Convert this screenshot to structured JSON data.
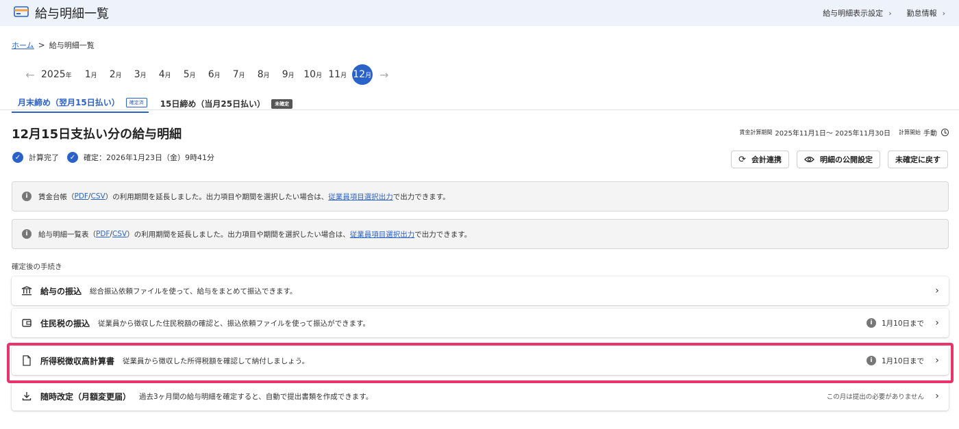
{
  "header": {
    "title": "給与明細一覧",
    "links": [
      {
        "label": "給与明細表示設定"
      },
      {
        "label": "勤怠情報"
      }
    ],
    "chevron": "›"
  },
  "breadcrumb": {
    "home": "ホーム",
    "separator": ">",
    "current": "給与明細一覧"
  },
  "months": {
    "prev_arrow": "←",
    "next_arrow": "→",
    "year": "2025",
    "year_suffix": "年",
    "month_suffix": "月",
    "items": [
      "1",
      "2",
      "3",
      "4",
      "5",
      "6",
      "7",
      "8",
      "9",
      "10",
      "11",
      "12"
    ],
    "selected": "12"
  },
  "tabs": [
    {
      "label": "月末締め（翌月15日払い）",
      "badge": "確定済",
      "active": true
    },
    {
      "label": "15日締め（当月25日払い）",
      "badge": "未確定",
      "active": false
    }
  ],
  "page": {
    "title": "12月15日支払い分の給与明細",
    "calc_period_label": "賃金計算期間",
    "calc_period_value": "2025年11月1日〜 2025年11月30日",
    "calc_start_label": "計算開始",
    "calc_start_value": "手動"
  },
  "status": {
    "calc_done": "計算完了",
    "confirmed": "確定：2026年1月23日（金）9時41分"
  },
  "buttons": {
    "accounting": "会計連携",
    "publish_settings": "明細の公開設定",
    "revert": "未確定に戻す"
  },
  "notices": [
    {
      "prefix": "賃金台帳（",
      "pdf": "PDF",
      "slash": "/",
      "csv": "CSV",
      "middle": "）の利用期間を延長しました。出力項目や期間を選択したい場合は、",
      "link": "従業員項目選択出力",
      "suffix": "で出力できます。"
    },
    {
      "prefix": "給与明細一覧表（",
      "pdf": "PDF",
      "slash": "/",
      "csv": "CSV",
      "middle": "）の利用期間を延長しました。出力項目や期間を選択したい場合は、",
      "link": "従業員項目選択出力",
      "suffix": "で出力できます。"
    }
  ],
  "procedures": {
    "section_label": "確定後の手続き",
    "items": [
      {
        "icon": "bank-icon",
        "title": "給与の振込",
        "desc": "総合振込依頼ファイルを使って、給与をまとめて振込できます。",
        "due": "",
        "note": ""
      },
      {
        "icon": "wallet-icon",
        "title": "住民税の振込",
        "desc": "従業員から徴収した住民税額の確認と、振込依頼ファイルを使って振込ができます。",
        "due": "1月10日まで",
        "note": ""
      },
      {
        "icon": "document-icon",
        "title": "所得税徴収高計算書",
        "desc": "従業員から徴収した所得税額を確認して納付しましょう。",
        "due": "1月10日まで",
        "note": ""
      },
      {
        "icon": "download-icon",
        "title": "随時改定（月額変更届）",
        "desc": "過去3ヶ月間の給与明細を確定すると、自動で提出書類を作成できます。",
        "due": "",
        "note": "この月は提出の必要がありません"
      }
    ]
  },
  "colors": {
    "accent": "#2a62c9",
    "highlight": "#e8336b",
    "header_bg": "#eef2fa"
  }
}
